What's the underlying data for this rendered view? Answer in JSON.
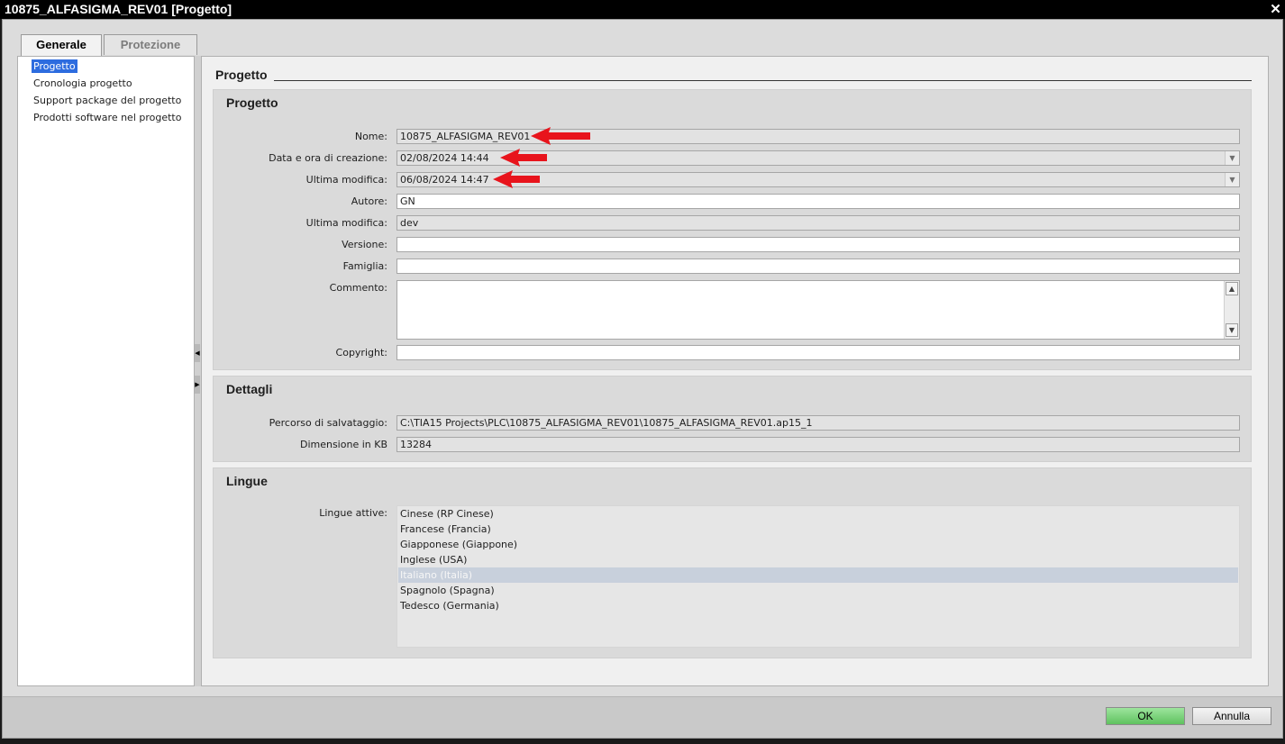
{
  "window": {
    "title": "10875_ALFASIGMA_REV01 [Progetto]",
    "close_glyph": "✕"
  },
  "tabs": [
    {
      "label": "Generale"
    },
    {
      "label": "Protezione"
    }
  ],
  "nav": {
    "items": [
      {
        "label": "Progetto"
      },
      {
        "label": "Cronologia progetto"
      },
      {
        "label": "Support package del progetto"
      },
      {
        "label": "Prodotti software nel progetto"
      }
    ]
  },
  "content": {
    "header": "Progetto"
  },
  "sections": {
    "progetto": {
      "title": "Progetto",
      "fields": [
        {
          "label": "Nome:",
          "value": "10875_ALFASIGMA_REV01"
        },
        {
          "label": "Data e ora di creazione:",
          "value": "02/08/2024 14:44"
        },
        {
          "label": "Ultima modifica:",
          "value": "06/08/2024 14:47"
        },
        {
          "label": "Autore:",
          "value": "GN"
        },
        {
          "label": "Ultima modifica:",
          "value": "dev"
        },
        {
          "label": "Versione:",
          "value": ""
        },
        {
          "label": "Famiglia:",
          "value": ""
        },
        {
          "label": "Commento:",
          "value": ""
        },
        {
          "label": "Copyright:",
          "value": ""
        }
      ]
    },
    "dettagli": {
      "title": "Dettagli",
      "fields": [
        {
          "label": "Percorso di salvataggio:",
          "value": "C:\\TIA15 Projects\\PLC\\10875_ALFASIGMA_REV01\\10875_ALFASIGMA_REV01.ap15_1"
        },
        {
          "label": "Dimensione in KB",
          "value": "13284"
        }
      ]
    },
    "lingue": {
      "title": "Lingue",
      "label": "Lingue attive:",
      "languages": [
        "Cinese (RP Cinese)",
        "Francese (Francia)",
        "Giapponese (Giappone)",
        "Inglese (USA)",
        "Italiano (Italia)",
        "Spagnolo (Spagna)",
        "Tedesco (Germania)"
      ],
      "selected": "Italiano (Italia)"
    }
  },
  "annotation": {
    "arrow_color": "#e8141c"
  },
  "buttons": {
    "ok": "OK",
    "cancel": "Annulla"
  }
}
